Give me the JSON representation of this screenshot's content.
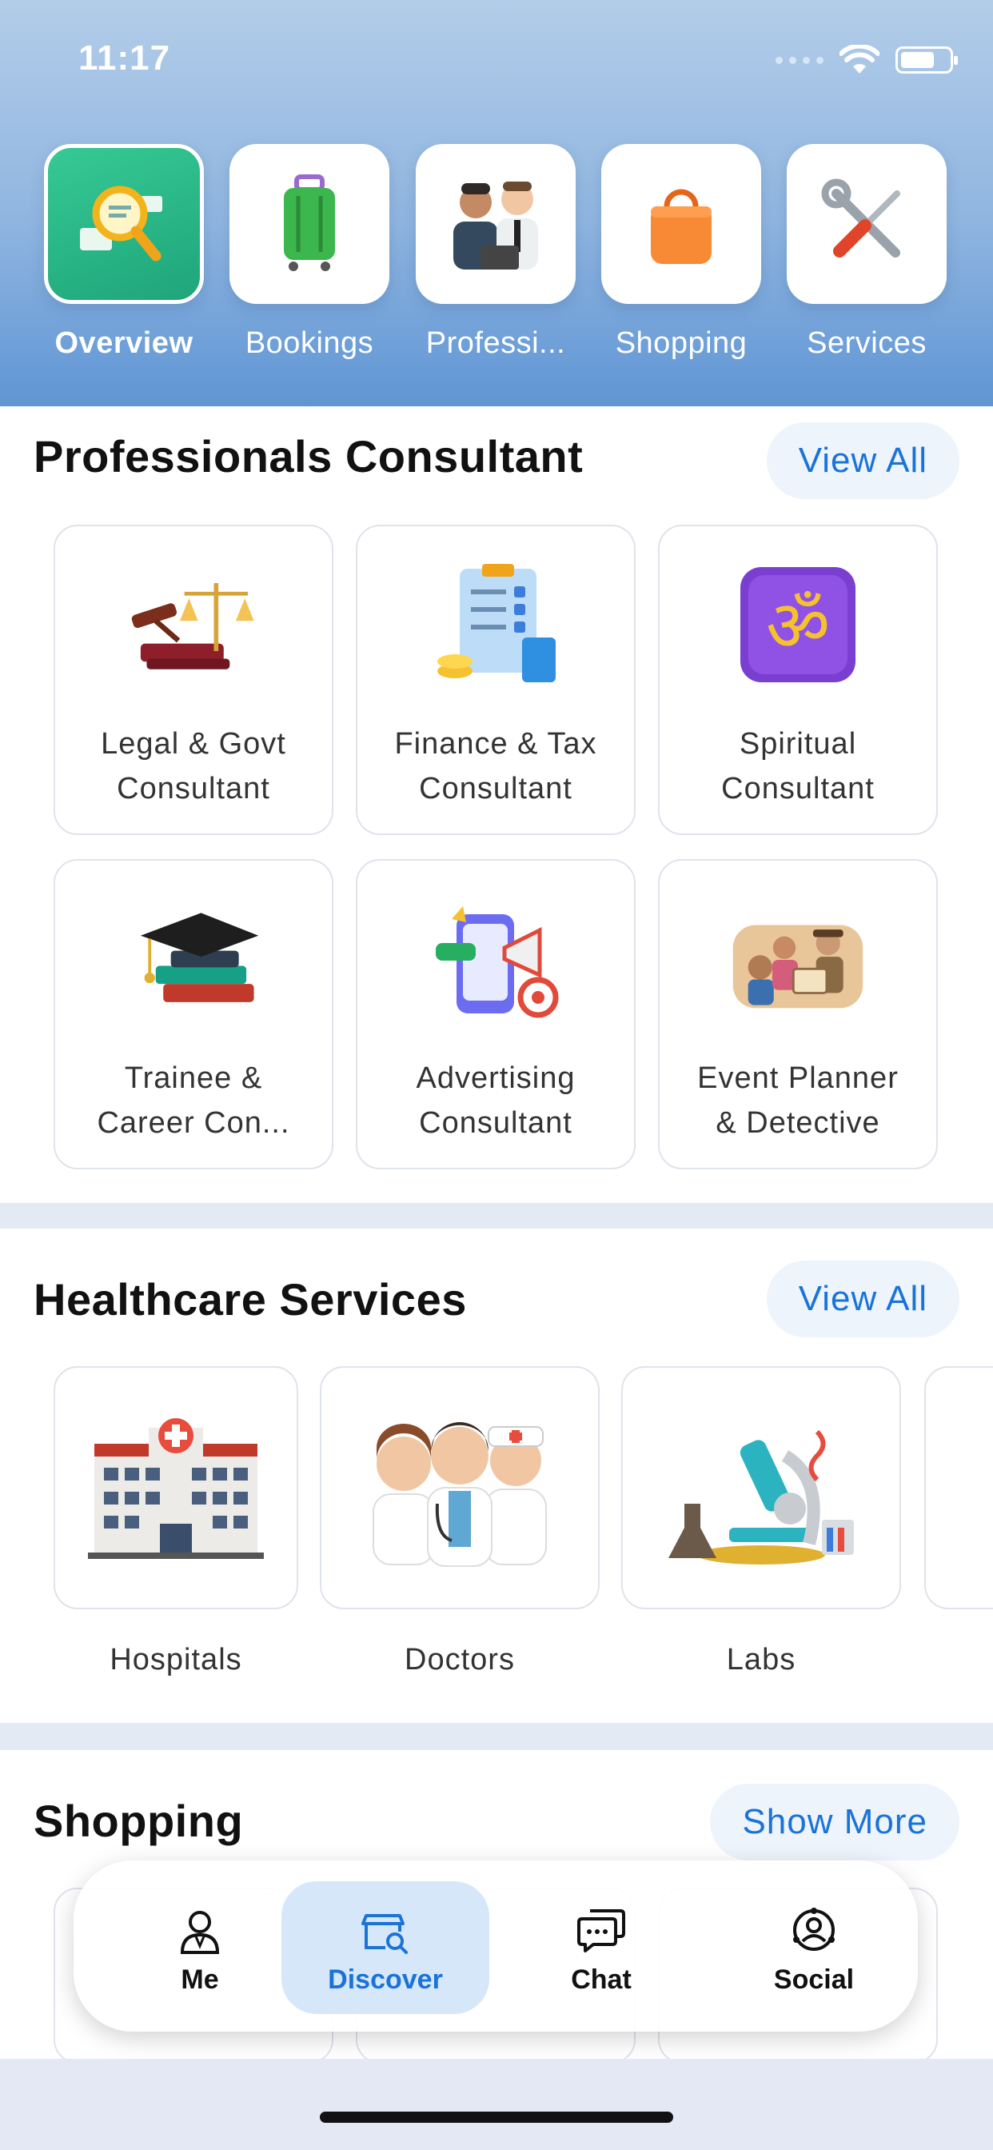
{
  "status_bar": {
    "time": "11:17"
  },
  "categories": [
    {
      "label": "Overview",
      "icon": "magnifier-icon",
      "active": true
    },
    {
      "label": "Bookings",
      "icon": "suitcase-icon",
      "active": false
    },
    {
      "label": "Professi...",
      "icon": "professionals-icon",
      "active": false
    },
    {
      "label": "Shopping",
      "icon": "shopping-bag-icon",
      "active": false
    },
    {
      "label": "Services",
      "icon": "tools-icon",
      "active": false
    }
  ],
  "professionals": {
    "title": "Professionals Consultant",
    "action": "View All",
    "items": [
      {
        "line1": "Legal & Govt",
        "line2": "Consultant",
        "icon": "scales-gavel-icon"
      },
      {
        "line1": "Finance & Tax",
        "line2": "Consultant",
        "icon": "clipboard-coins-icon"
      },
      {
        "line1": "Spiritual",
        "line2": "Consultant",
        "icon": "om-icon"
      },
      {
        "line1": "Trainee &",
        "line2": "Career Con...",
        "icon": "graduation-cap-books-icon"
      },
      {
        "line1": "Advertising",
        "line2": "Consultant",
        "icon": "megaphone-target-icon"
      },
      {
        "line1": "Event Planner",
        "line2": "& Detective",
        "icon": "event-detective-icon"
      }
    ]
  },
  "healthcare": {
    "title": "Healthcare Services",
    "action": "View All",
    "items": [
      {
        "label": "Hospitals",
        "icon": "hospital-icon"
      },
      {
        "label": "Doctors",
        "icon": "doctors-icon"
      },
      {
        "label": "Labs",
        "icon": "microscope-icon"
      }
    ]
  },
  "shopping": {
    "title": "Shopping",
    "action": "Show More"
  },
  "bottom_nav": [
    {
      "label": "Me",
      "icon": "person-icon",
      "active": false
    },
    {
      "label": "Discover",
      "icon": "discover-icon",
      "active": true
    },
    {
      "label": "Chat",
      "icon": "chat-icon",
      "active": false
    },
    {
      "label": "Social",
      "icon": "social-icon",
      "active": false
    }
  ],
  "colors": {
    "accent": "#1a73d9",
    "active_tab": "#1fa57a",
    "header_top": "#b3cde9",
    "header_bottom": "#5f95d4"
  }
}
